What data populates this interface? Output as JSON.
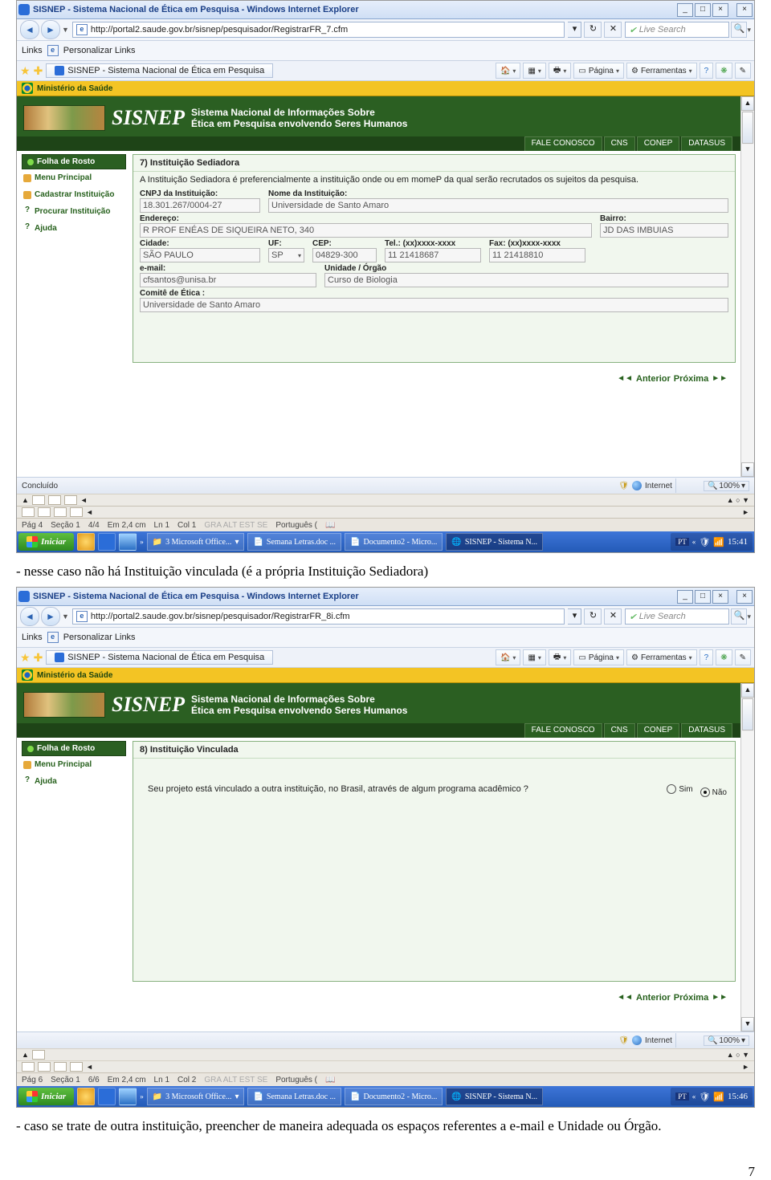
{
  "page_number": "7",
  "caption1": "- nesse caso não há Instituição vinculada (é a própria Instituição Sediadora)",
  "caption2_a": "- caso se trate de outra instituição, preencher de maneira adequada os espaços referentes a e-mail e Unidade ou Órgão.",
  "ie": {
    "title": "SISNEP - Sistema Nacional de Ética em Pesquisa - Windows Internet Explorer",
    "links_label": "Links",
    "personalize": "Personalizar Links",
    "tab_title": "SISNEP - Sistema Nacional de Ética em Pesquisa",
    "search_ph": "Live Search",
    "btn_page": "Página",
    "btn_tools": "Ferramentas",
    "status_done": "Concluído",
    "status_net": "Internet",
    "status_zoom": "100%"
  },
  "url1": "http://portal2.saude.gov.br/sisnep/pesquisador/RegistrarFR_7.cfm",
  "url2": "http://portal2.saude.gov.br/sisnep/pesquisador/RegistrarFR_8i.cfm",
  "gold_label": "Ministério da Saúde",
  "banner": {
    "logo": "SISNEP",
    "sub1": "Sistema Nacional de Informações Sobre",
    "sub2": "Ética em Pesquisa envolvendo Seres Humanos",
    "nav": [
      "FALE CONOSCO",
      "CNS",
      "CONEP",
      "DATASUS"
    ]
  },
  "side": {
    "head": "Folha de Rosto",
    "menu": "Menu Principal",
    "cad": "Cadastrar Instituição",
    "proc": "Procurar Instituição",
    "help": "Ajuda"
  },
  "form7": {
    "title": "7) Instituição Sediadora",
    "desc": "A Instituição Sediadora é preferencialmente a instituição onde ou em momeP da qual serão recrutados os sujeitos da pesquisa.",
    "cnpj_l": "CNPJ da Instituição:",
    "cnpj_v": "18.301.267/0004-27",
    "nome_l": "Nome da Instituição:",
    "nome_v": "Universidade de Santo Amaro",
    "end_l": "Endereço:",
    "end_v": "R PROF ENÉAS DE SIQUEIRA NETO, 340",
    "bairro_l": "Bairro:",
    "bairro_v": "JD DAS IMBUIAS",
    "cidade_l": "Cidade:",
    "cidade_v": "SÃO PAULO",
    "uf_l": "UF:",
    "uf_v": "SP",
    "cep_l": "CEP:",
    "cep_v": "04829-300",
    "tel_l": "Tel.: (xx)xxxx-xxxx",
    "tel_v": "11 21418687",
    "fax_l": "Fax: (xx)xxxx-xxxx",
    "fax_v": "11 21418810",
    "email_l": "e-mail:",
    "email_v": "cfsantos@unisa.br",
    "uni_l": "Unidade / Órgão",
    "uni_v": "Curso de Biologia",
    "comite_l": "Comitê de Ética :",
    "comite_v": "Universidade de Santo Amaro",
    "prev": "Anterior",
    "next": "Próxima"
  },
  "form8": {
    "title": "8) Instituição Vinculada",
    "q": "Seu projeto está vinculado a outra instituição, no Brasil, através de algum programa acadêmico ?",
    "sim": "Sim",
    "nao": "Não",
    "prev": "Anterior",
    "next": "Próxima"
  },
  "word1": {
    "pag": "Pág 4",
    "sec": "Seção 1",
    "cnt": "4/4",
    "em": "Em 2,4 cm",
    "ln": "Ln 1",
    "col": "Col 1",
    "flags": "GRA  ALT  EST  SE",
    "lang": "Português (",
    "time": "15:41"
  },
  "word2": {
    "pag": "Pág 6",
    "sec": "Seção 1",
    "cnt": "6/6",
    "em": "Em 2,4 cm",
    "ln": "Ln 1",
    "col": "Col 2",
    "flags": "GRA  ALT  EST  SE",
    "lang": "Português (",
    "time": "15:46"
  },
  "taskbar": {
    "start": "Iniciar",
    "t1": "3 Microsoft Office...",
    "t2": "Semana Letras.doc ...",
    "t3": "Documento2 - Micro...",
    "t4": "SISNEP - Sistema N...",
    "lang": "PT"
  }
}
